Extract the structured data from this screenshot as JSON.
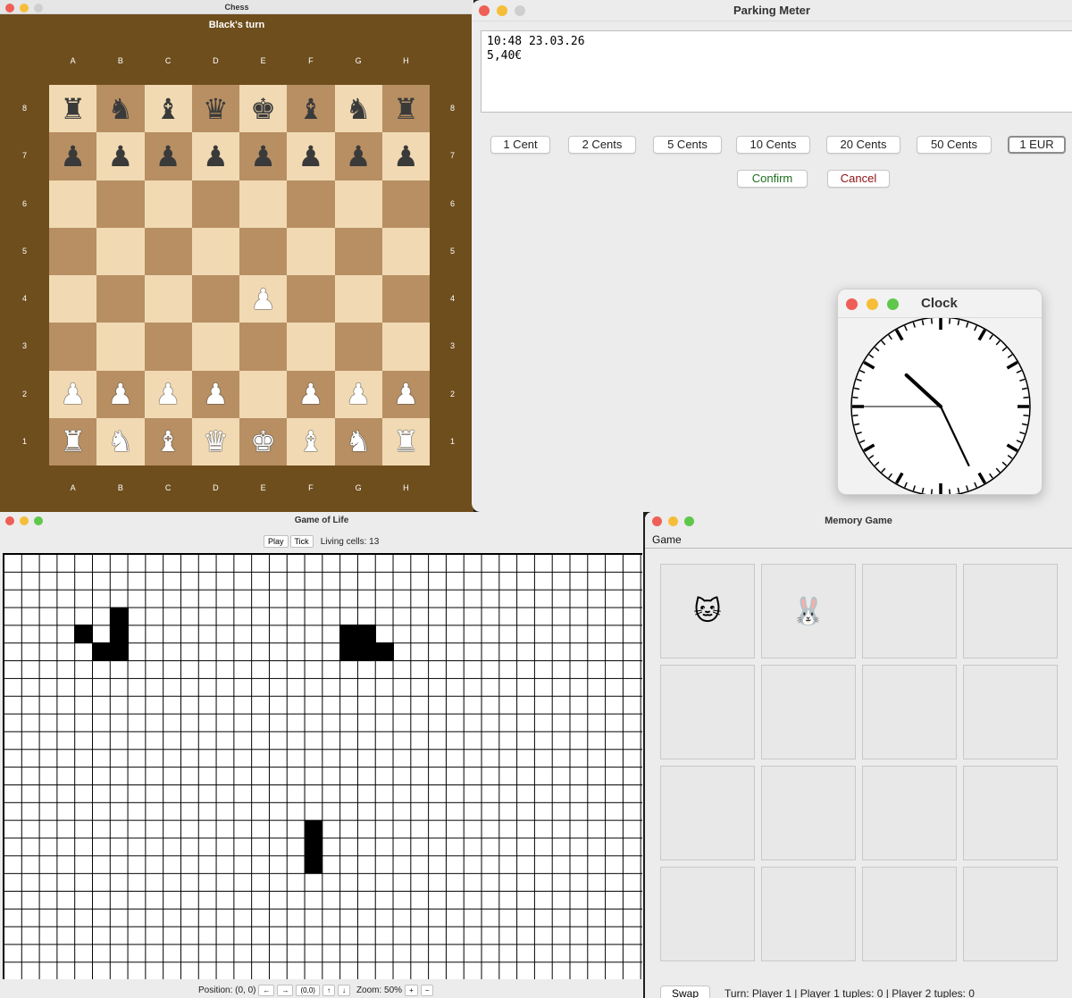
{
  "chess": {
    "title": "Chess",
    "turn": "Black's turn",
    "files": [
      "A",
      "B",
      "C",
      "D",
      "E",
      "F",
      "G",
      "H"
    ],
    "ranks": [
      "8",
      "7",
      "6",
      "5",
      "4",
      "3",
      "2",
      "1"
    ],
    "board": [
      [
        "bR",
        "bN",
        "bB",
        "bQ",
        "bK",
        "bB",
        "bN",
        "bR"
      ],
      [
        "bP",
        "bP",
        "bP",
        "bP",
        "bP",
        "bP",
        "bP",
        "bP"
      ],
      [
        "",
        "",
        "",
        "",
        "",
        "",
        "",
        ""
      ],
      [
        "",
        "",
        "",
        "",
        "",
        "",
        "",
        ""
      ],
      [
        "",
        "",
        "",
        "",
        "wP",
        "",
        "",
        ""
      ],
      [
        "",
        "",
        "",
        "",
        "",
        "",
        "",
        ""
      ],
      [
        "wP",
        "wP",
        "wP",
        "wP",
        "",
        "wP",
        "wP",
        "wP"
      ],
      [
        "wR",
        "wN",
        "wB",
        "wQ",
        "wK",
        "wB",
        "wN",
        "wR"
      ]
    ],
    "colors": {
      "frame": "#6e4e1d",
      "light": "#f1dab3",
      "dark": "#b78f63"
    }
  },
  "parking_meter": {
    "title": "Parking Meter",
    "display_line1": "10:48 23.03.26",
    "display_line2": "5,40€",
    "coins": [
      "1 Cent",
      "2 Cents",
      "5 Cents",
      "10 Cents",
      "20 Cents",
      "50 Cents",
      "1 EUR"
    ],
    "confirm_label": "Confirm",
    "cancel_label": "Cancel"
  },
  "clock": {
    "title": "Clock",
    "time": {
      "hour": 10,
      "minute": 25,
      "second": 45
    }
  },
  "game_of_life": {
    "title": "Game of Life",
    "play_label": "Play",
    "tick_label": "Tick",
    "living_cells": "Living cells: 13",
    "position": "Position: (0, 0)",
    "left_label": "←",
    "right_label": "→",
    "origin_label": "(0,0)",
    "up_label": "↑",
    "down_label": "↓",
    "zoom": "Zoom: 50%",
    "zoom_in_label": "+",
    "zoom_out_label": "−",
    "live_cells": [
      [
        4,
        4
      ],
      [
        6,
        3
      ],
      [
        6,
        4
      ],
      [
        5,
        5
      ],
      [
        6,
        5
      ],
      [
        19,
        4
      ],
      [
        20,
        4
      ],
      [
        19,
        5
      ],
      [
        20,
        5
      ],
      [
        21,
        5
      ],
      [
        17,
        15
      ],
      [
        17,
        16
      ],
      [
        17,
        17
      ]
    ]
  },
  "memory": {
    "title": "Memory Game",
    "menu": "Game",
    "cards": [
      "🐱",
      "🐰",
      "",
      "",
      "",
      "",
      "",
      "",
      "",
      "",
      "",
      "",
      "",
      "",
      "",
      ""
    ],
    "swap_label": "Swap",
    "status": "Turn: Player 1  |  Player 1 tuples: 0  |  Player 2 tuples: 0"
  }
}
